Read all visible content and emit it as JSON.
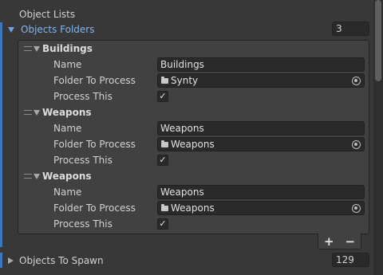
{
  "section_title": "Object Lists",
  "objects_folders": {
    "label": "Objects Folders",
    "count": "3"
  },
  "elements": [
    {
      "title": "Buildings",
      "name_label": "Name",
      "name_value": "Buildings",
      "folder_label": "Folder To Process",
      "folder_value": "Synty",
      "process_label": "Process This",
      "process_checked": true,
      "check_mark": "✓"
    },
    {
      "title": "Weapons",
      "name_label": "Name",
      "name_value": "Weapons",
      "folder_label": "Folder To Process",
      "folder_value": "Weapons",
      "process_label": "Process This",
      "process_checked": true,
      "check_mark": "✓"
    },
    {
      "title": "Weapons",
      "name_label": "Name",
      "name_value": "Weapons",
      "folder_label": "Folder To Process",
      "folder_value": "Weapons",
      "process_label": "Process This",
      "process_checked": true,
      "check_mark": "✓"
    }
  ],
  "list_footer": {
    "add": "+",
    "remove": "−"
  },
  "objects_to_spawn": {
    "label": "Objects To Spawn",
    "count": "129"
  },
  "colors": {
    "accent": "#3a79bb",
    "label_blue": "#7fb6f0",
    "background": "#383838"
  },
  "icons": {
    "folder": "folder-icon",
    "picker": "object-picker-icon",
    "foldout": "foldout-arrow-icon"
  }
}
